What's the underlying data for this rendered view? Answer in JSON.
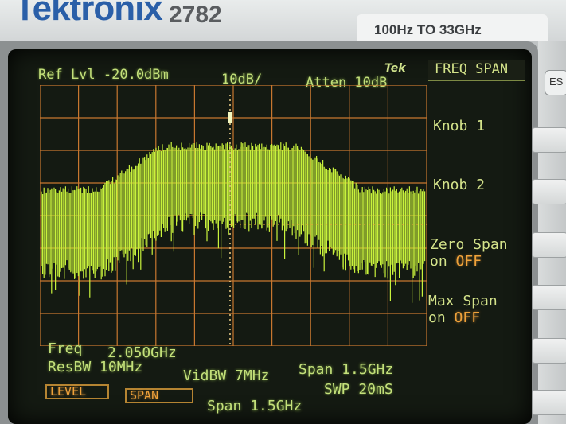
{
  "instrument": {
    "brand": "Tektronix",
    "model": "2782",
    "range": "100Hz TO 33GHz",
    "esc_key": "ES"
  },
  "header": {
    "ref_level": "Ref Lvl -20.0dBm",
    "scale": "10dB/",
    "attenuation": "Atten 10dB",
    "logo": "Tek"
  },
  "menu": {
    "title": "FREQ SPAN",
    "softkeys": [
      {
        "line1": "Knob 1",
        "line2": ""
      },
      {
        "line1": "Knob 2",
        "line2": ""
      },
      {
        "line1": "Zero Span",
        "line2_on": "on",
        "line2_off": "OFF"
      },
      {
        "line1": "Max Span",
        "line2_on": "on",
        "line2_off": "OFF"
      }
    ]
  },
  "readouts": {
    "freq_label": "Freq",
    "freq_value": "2.050GHz",
    "resbw": "ResBW 10MHz",
    "vidbw": "VidBW 7MHz",
    "span": "Span 1.5GHz",
    "sweep": "SWP 20mS"
  },
  "bottom_bar": {
    "level_button": "LEVEL",
    "span_button": "SPAN",
    "status": "Span 1.5GHz"
  },
  "colors": {
    "trace": "#c8f23c",
    "graticule": "#c7772f",
    "text": "#c3e07a",
    "highlight": "#f0a23a"
  }
}
